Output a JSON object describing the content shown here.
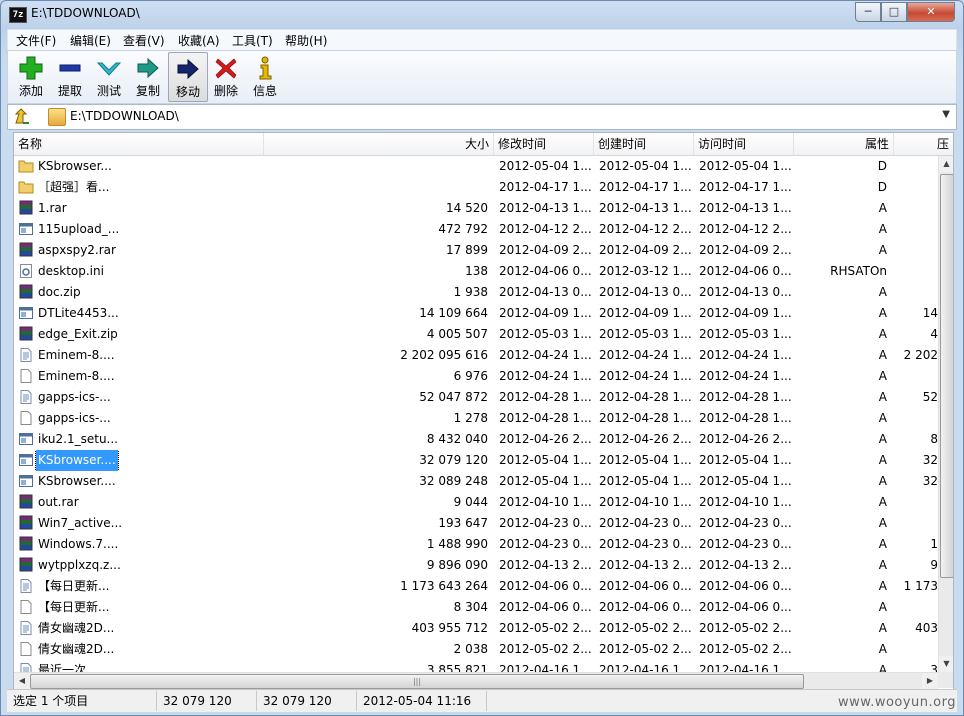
{
  "window": {
    "title": "E:\\TDDOWNLOAD\\",
    "app_icon": "7z"
  },
  "menu": [
    "文件(F)",
    "编辑(E)",
    "查看(V)",
    "收藏(A)",
    "工具(T)",
    "帮助(H)"
  ],
  "toolbar": [
    {
      "label": "添加",
      "icon": "add-icon",
      "color": "#1faa1f"
    },
    {
      "label": "提取",
      "icon": "extract-icon",
      "color": "#1e3aa8"
    },
    {
      "label": "测试",
      "icon": "test-icon",
      "color": "#27b0c4"
    },
    {
      "label": "复制",
      "icon": "copy-icon",
      "color": "#1a8a7a"
    },
    {
      "label": "移动",
      "icon": "move-icon",
      "color": "#14246e"
    },
    {
      "label": "删除",
      "icon": "delete-icon",
      "color": "#d01818"
    },
    {
      "label": "信息",
      "icon": "info-icon",
      "color": "#e0b400"
    }
  ],
  "address": {
    "path": "E:\\TDDOWNLOAD\\"
  },
  "columns": [
    "名称",
    "大小",
    "修改时间",
    "创建时间",
    "访问时间",
    "属性",
    "压"
  ],
  "files": [
    {
      "name": "KSbrowser...",
      "size": "",
      "modified": "2012-05-04 1...",
      "created": "2012-05-04 1...",
      "accessed": "2012-05-04 1...",
      "attr": "D",
      "packed": "",
      "icon": "folder"
    },
    {
      "name": "［超强］看...",
      "size": "",
      "modified": "2012-04-17 1...",
      "created": "2012-04-17 1...",
      "accessed": "2012-04-17 1...",
      "attr": "D",
      "packed": "",
      "icon": "folder"
    },
    {
      "name": "1.rar",
      "size": "14 520",
      "modified": "2012-04-13 1...",
      "created": "2012-04-13 1...",
      "accessed": "2012-04-13 1...",
      "attr": "A",
      "packed": "",
      "icon": "rar"
    },
    {
      "name": "115upload_...",
      "size": "472 792",
      "modified": "2012-04-12 2...",
      "created": "2012-04-12 2...",
      "accessed": "2012-04-12 2...",
      "attr": "A",
      "packed": "",
      "icon": "exe"
    },
    {
      "name": "aspxspy2.rar",
      "size": "17 899",
      "modified": "2012-04-09 2...",
      "created": "2012-04-09 2...",
      "accessed": "2012-04-09 2...",
      "attr": "A",
      "packed": "",
      "icon": "rar"
    },
    {
      "name": "desktop.ini",
      "size": "138",
      "modified": "2012-04-06 0...",
      "created": "2012-03-12 1...",
      "accessed": "2012-04-06 0...",
      "attr": "RHSATOn",
      "packed": "",
      "icon": "ini"
    },
    {
      "name": "doc.zip",
      "size": "1 938",
      "modified": "2012-04-13 0...",
      "created": "2012-04-13 0...",
      "accessed": "2012-04-13 0...",
      "attr": "A",
      "packed": "",
      "icon": "rar"
    },
    {
      "name": "DTLite4453...",
      "size": "14 109 664",
      "modified": "2012-04-09 1...",
      "created": "2012-04-09 1...",
      "accessed": "2012-04-09 1...",
      "attr": "A",
      "packed": "14",
      "icon": "exe"
    },
    {
      "name": "edge_Exit.zip",
      "size": "4 005 507",
      "modified": "2012-05-03 1...",
      "created": "2012-05-03 1...",
      "accessed": "2012-05-03 1...",
      "attr": "A",
      "packed": "4",
      "icon": "rar"
    },
    {
      "name": "Eminem-8....",
      "size": "2 202 095 616",
      "modified": "2012-04-24 1...",
      "created": "2012-04-24 1...",
      "accessed": "2012-04-24 1...",
      "attr": "A",
      "packed": "2 202",
      "icon": "text"
    },
    {
      "name": "Eminem-8....",
      "size": "6 976",
      "modified": "2012-04-24 1...",
      "created": "2012-04-24 1...",
      "accessed": "2012-04-24 1...",
      "attr": "A",
      "packed": "",
      "icon": "blank"
    },
    {
      "name": "gapps-ics-...",
      "size": "52 047 872",
      "modified": "2012-04-28 1...",
      "created": "2012-04-28 1...",
      "accessed": "2012-04-28 1...",
      "attr": "A",
      "packed": "52",
      "icon": "text"
    },
    {
      "name": "gapps-ics-...",
      "size": "1 278",
      "modified": "2012-04-28 1...",
      "created": "2012-04-28 1...",
      "accessed": "2012-04-28 1...",
      "attr": "A",
      "packed": "",
      "icon": "blank"
    },
    {
      "name": "iku2.1_setu...",
      "size": "8 432 040",
      "modified": "2012-04-26 2...",
      "created": "2012-04-26 2...",
      "accessed": "2012-04-26 2...",
      "attr": "A",
      "packed": "8",
      "icon": "exe"
    },
    {
      "name": "KSbrowser....",
      "size": "32 079 120",
      "modified": "2012-05-04 1...",
      "created": "2012-05-04 1...",
      "accessed": "2012-05-04 1...",
      "attr": "A",
      "packed": "32",
      "icon": "exe",
      "selected": true
    },
    {
      "name": "KSbrowser....",
      "size": "32 089 248",
      "modified": "2012-05-04 1...",
      "created": "2012-05-04 1...",
      "accessed": "2012-05-04 1...",
      "attr": "A",
      "packed": "32",
      "icon": "exe"
    },
    {
      "name": "out.rar",
      "size": "9 044",
      "modified": "2012-04-10 1...",
      "created": "2012-04-10 1...",
      "accessed": "2012-04-10 1...",
      "attr": "A",
      "packed": "",
      "icon": "rar"
    },
    {
      "name": "Win7_active...",
      "size": "193 647",
      "modified": "2012-04-23 0...",
      "created": "2012-04-23 0...",
      "accessed": "2012-04-23 0...",
      "attr": "A",
      "packed": "",
      "icon": "rar"
    },
    {
      "name": "Windows.7....",
      "size": "1 488 990",
      "modified": "2012-04-23 0...",
      "created": "2012-04-23 0...",
      "accessed": "2012-04-23 0...",
      "attr": "A",
      "packed": "1",
      "icon": "rar"
    },
    {
      "name": "wytpplxzq.z...",
      "size": "9 896 090",
      "modified": "2012-04-13 2...",
      "created": "2012-04-13 2...",
      "accessed": "2012-04-13 2...",
      "attr": "A",
      "packed": "9",
      "icon": "rar"
    },
    {
      "name": "【每日更新...",
      "size": "1 173 643 264",
      "modified": "2012-04-06 0...",
      "created": "2012-04-06 0...",
      "accessed": "2012-04-06 0...",
      "attr": "A",
      "packed": "1 173",
      "icon": "text"
    },
    {
      "name": "【每日更新...",
      "size": "8 304",
      "modified": "2012-04-06 0...",
      "created": "2012-04-06 0...",
      "accessed": "2012-04-06 0...",
      "attr": "A",
      "packed": "",
      "icon": "blank"
    },
    {
      "name": "倩女幽魂2D...",
      "size": "403 955 712",
      "modified": "2012-05-02 2...",
      "created": "2012-05-02 2...",
      "accessed": "2012-05-02 2...",
      "attr": "A",
      "packed": "403",
      "icon": "text"
    },
    {
      "name": "倩女幽魂2D...",
      "size": "2 038",
      "modified": "2012-05-02 2...",
      "created": "2012-05-02 2...",
      "accessed": "2012-05-02 2...",
      "attr": "A",
      "packed": "",
      "icon": "blank"
    },
    {
      "name": "最近一次...",
      "size": "3 855 821",
      "modified": "2012-04-16 1...",
      "created": "2012-04-16 1...",
      "accessed": "2012-04-16 1...",
      "attr": "A",
      "packed": "3",
      "icon": "text"
    }
  ],
  "status": {
    "selection": "选定 1 个项目",
    "size": "32 079 120",
    "packed": "32 079 120",
    "modified": "2012-05-04 11:16"
  },
  "watermark": "www.wooyun.org"
}
